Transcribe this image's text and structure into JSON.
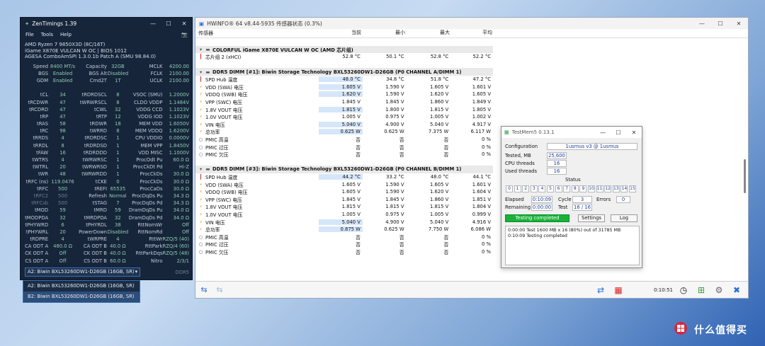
{
  "zt": {
    "title": "ZenTimings 1.39",
    "menu": [
      "File",
      "Tools",
      "Help"
    ],
    "info": [
      "AMD Ryzen 7 9850X3D (8C/16T)",
      "iGame X870E VULCAN W OC | BIOS 1012",
      "AGESA ComboAmSPI 1.3.0.1b Patch A (SMU 98.84.0)"
    ],
    "rows": [
      [
        "Speed",
        "8400 MT/s",
        "Capacity",
        "32GB",
        "MCLK",
        "4200.00"
      ],
      [
        "BGS",
        "Enabled",
        "BGS Alt",
        "Disabled",
        "FCLK",
        "2100.00"
      ],
      [
        "GDM",
        "Enabled",
        "Cmd2T",
        "1T",
        "UCLK",
        "2100.00"
      ],
      [
        "",
        "",
        "",
        "",
        "",
        ""
      ],
      [
        "tCL",
        "34",
        "tRDRDSCL",
        "8",
        "VSOC (SMU)",
        "1.2000V"
      ],
      [
        "tRCDWR",
        "47",
        "tWRWRSCL",
        "8",
        "CLDO VDDP",
        "1.1484V"
      ],
      [
        "tRCDRD",
        "47",
        "tCWL",
        "32",
        "VDDG CCD",
        "1.1023V"
      ],
      [
        "tRP",
        "47",
        "tRTP",
        "12",
        "VDDG IOD",
        "1.1023V"
      ],
      [
        "tRAS",
        "58",
        "tRDWR",
        "18",
        "MEM VDD",
        "1.6050V"
      ],
      [
        "tRC",
        "98",
        "tWRRD",
        "8",
        "MEM VDDQ",
        "1.6200V"
      ],
      [
        "tRRDS",
        "4",
        "tRDRDSC",
        "1",
        "CPU VDDIO",
        "0.0000V"
      ],
      [
        "tRRDL",
        "8",
        "tRDRDSD",
        "1",
        "MEM VPP",
        "1.8450V"
      ],
      [
        "tFAW",
        "16",
        "tRDRDDD",
        "1",
        "VDD MISC",
        "1.1000V"
      ],
      [
        "tWTRS",
        "4",
        "tWRWRSC",
        "1",
        "ProcOdt Pu",
        "60.0 Ω"
      ],
      [
        "tWTRL",
        "20",
        "tWRWRSD",
        "1",
        "ProcCkDt Pd",
        "Hi-Z"
      ],
      [
        "tWR",
        "48",
        "tWRWRDD",
        "1",
        "ProcCkDs",
        "30.0 Ω"
      ],
      [
        "tRFC (ns)",
        "119.0476",
        "tCKE",
        "0",
        "ProcCkDs",
        "30.0 Ω"
      ],
      [
        "tRFC",
        "500",
        "tREFI",
        "65535",
        "ProcCaDs",
        "30.0 Ω"
      ],
      [
        "tRFC2",
        "500",
        "Refresh",
        "Normal",
        "ProcDqDs Pu",
        "34.3 Ω"
      ],
      [
        "tRFCsb",
        "500",
        "tSTAG",
        "7",
        "ProcDqDs Pd",
        "34.3 Ω"
      ],
      [
        "tMOD",
        "59",
        "tMRD",
        "59",
        "DramDqDs Pu",
        "34.0 Ω"
      ],
      [
        "tMODPDA",
        "32",
        "tMRDPDA",
        "32",
        "DramDqDs Pd",
        "34.0 Ω"
      ],
      [
        "tPHYWRD",
        "6",
        "tPHYRDL",
        "38",
        "RttNomWr",
        "Off"
      ],
      [
        "tPHYWRL",
        "20",
        "PowerDown",
        "Disabled",
        "RttNomRd",
        "Off"
      ],
      [
        "tRDPRE",
        "4",
        "tWRPRE",
        "4",
        "RttWr",
        "RZQ/5 (40)"
      ],
      [
        "CA ODT A",
        "480.0 Ω",
        "CA ODT B",
        "40.0 Ω",
        "RttPark",
        "RZQ/4 (60)"
      ],
      [
        "CK ODT A",
        "Off",
        "CK ODT B",
        "40.0 Ω",
        "RttParkDqs",
        "RZQ/5 (48)"
      ],
      [
        "CS ODT A",
        "Off",
        "CS ODT B",
        "60.0 Ω",
        "Nitro",
        "2/3/1"
      ]
    ],
    "select": "A2: Biwin BXL53260DW1-D26GB (16GB, SR)",
    "ddr": "DDR5",
    "options": [
      "A2: Biwin BXL53260DW1-D26GB (16GB, SR)",
      "B2: Biwin BXL53260DW1-D26GB (16GB, SR)"
    ]
  },
  "hw": {
    "title": "HWiNFO® 64 v8.44-5935 传感器状态 (0.3%)",
    "headers": [
      "传感器",
      "当前",
      "最小",
      "最大",
      "平均"
    ],
    "rows": [
      {
        "t": "blank"
      },
      {
        "t": "g",
        "n": "COLORFUL iGame X870E VULCAN W OC (AMD 芯片组)"
      },
      {
        "t": "r",
        "i": "r",
        "n": "芯片组 2 (xHCI)",
        "v": [
          "52.8 °C",
          "50.1 °C",
          "52.8 °C",
          "52.2 °C"
        ]
      },
      {
        "t": "blank"
      },
      {
        "t": "g",
        "n": "DDR5 DIMM [#1]: Biwin Storage Technology BXL53260DW1-D26GB (P0 CHANNEL A/DIMM 1)"
      },
      {
        "t": "r",
        "i": "r",
        "n": "SPD Hub 温度",
        "v": [
          "48.0 °C",
          "34.8 °C",
          "51.8 °C",
          "47.2 °C"
        ],
        "h": true
      },
      {
        "t": "r",
        "i": "y",
        "n": "VDD (SWA) 电压",
        "v": [
          "1.605 V",
          "1.590 V",
          "1.605 V",
          "1.601 V"
        ],
        "h": true
      },
      {
        "t": "r",
        "i": "y",
        "n": "VDDQ (SWB) 电压",
        "v": [
          "1.620 V",
          "1.590 V",
          "1.620 V",
          "1.605 V"
        ],
        "h": true
      },
      {
        "t": "r",
        "i": "y",
        "n": "VPP (SWC) 电压",
        "v": [
          "1.845 V",
          "1.845 V",
          "1.860 V",
          "1.849 V"
        ]
      },
      {
        "t": "r",
        "i": "y",
        "n": "1.8V VOUT 电压",
        "v": [
          "1.815 V",
          "1.800 V",
          "1.815 V",
          "1.805 V"
        ],
        "h": true
      },
      {
        "t": "r",
        "i": "y",
        "n": "1.0V VOUT 电压",
        "v": [
          "1.005 V",
          "0.975 V",
          "1.005 V",
          "1.002 V"
        ]
      },
      {
        "t": "r",
        "i": "y",
        "n": "VIN 电压",
        "v": [
          "5.040 V",
          "4.900 V",
          "5.040 V",
          "4.917 V"
        ],
        "h": true
      },
      {
        "t": "r",
        "i": "y",
        "n": "总功率",
        "v": [
          "0.625 W",
          "0.625 W",
          "7.375 W",
          "6.117 W"
        ],
        "h": true
      },
      {
        "t": "r",
        "i": "b",
        "n": "PMIC 高温",
        "v": [
          "否",
          "否",
          "否",
          "0 %"
        ]
      },
      {
        "t": "r",
        "i": "b",
        "n": "PMIC 过压",
        "v": [
          "否",
          "否",
          "否",
          "0 %"
        ]
      },
      {
        "t": "r",
        "i": "b",
        "n": "PMIC 欠压",
        "v": [
          "否",
          "否",
          "否",
          "0 %"
        ]
      },
      {
        "t": "blank"
      },
      {
        "t": "g",
        "n": "DDR5 DIMM [#3]: Biwin Storage Technology BXL53260DW1-D26GB (P0 CHANNEL B/DIMM 1)"
      },
      {
        "t": "r",
        "i": "r",
        "n": "SPD Hub 温度",
        "v": [
          "44.2 °C",
          "33.2 °C",
          "48.0 °C",
          "44.1 °C"
        ],
        "h": true
      },
      {
        "t": "r",
        "i": "y",
        "n": "VDD (SWA) 电压",
        "v": [
          "1.605 V",
          "1.590 V",
          "1.605 V",
          "1.601 V"
        ]
      },
      {
        "t": "r",
        "i": "y",
        "n": "VDDQ (SWB) 电压",
        "v": [
          "1.605 V",
          "1.590 V",
          "1.620 V",
          "1.604 V"
        ]
      },
      {
        "t": "r",
        "i": "y",
        "n": "VPP (SWC) 电压",
        "v": [
          "1.845 V",
          "1.845 V",
          "1.860 V",
          "1.851 V"
        ]
      },
      {
        "t": "r",
        "i": "y",
        "n": "1.8V VOUT 电压",
        "v": [
          "1.815 V",
          "1.815 V",
          "1.815 V",
          "1.804 V"
        ]
      },
      {
        "t": "r",
        "i": "y",
        "n": "1.0V VOUT 电压",
        "v": [
          "1.005 V",
          "0.975 V",
          "1.005 V",
          "0.999 V"
        ]
      },
      {
        "t": "r",
        "i": "y",
        "n": "VIN 电压",
        "v": [
          "5.040 V",
          "4.900 V",
          "5.040 V",
          "4.916 V"
        ],
        "h": true
      },
      {
        "t": "r",
        "i": "y",
        "n": "总功率",
        "v": [
          "0.875 W",
          "0.625 W",
          "7.750 W",
          "6.086 W"
        ],
        "h": true
      },
      {
        "t": "r",
        "i": "b",
        "n": "PMIC 高温",
        "v": [
          "否",
          "否",
          "否",
          "0 %"
        ]
      },
      {
        "t": "r",
        "i": "b",
        "n": "PMIC 过压",
        "v": [
          "否",
          "否",
          "否",
          "0 %"
        ]
      },
      {
        "t": "r",
        "i": "b",
        "n": "PMIC 欠压",
        "v": [
          "否",
          "否",
          "否",
          "0 %"
        ]
      }
    ],
    "time": "0:10:51"
  },
  "tm": {
    "title": "TestMem5  0.13.1",
    "config_label": "Configuration",
    "config": "1usmus v3 @ 1usmus",
    "tested_label": "Tested, MB",
    "tested": "25,600",
    "cpu_label": "CPU threads",
    "cpu": "16",
    "used_label": "Used threads",
    "used": "16",
    "status_label": "Status",
    "tests": [
      "0",
      "1",
      "2",
      "3",
      "4",
      "5",
      "6",
      "7",
      "8",
      "9",
      "10",
      "11",
      "12",
      "13",
      "14",
      "15"
    ],
    "elapsed_label": "Elapsed",
    "elapsed": "0:10:09",
    "cycle_label": "Cycle",
    "cycle": "3",
    "errors_label": "Errors",
    "errors": "0",
    "remaining_label": "Remaining",
    "remaining": "0:00:00",
    "test_label": "Test",
    "test": "16 / 16",
    "btn_status": "Testing completed",
    "btn_settings": "Settings",
    "btn_log": "Log",
    "log": [
      "0:00:00  Test 1600 MB x 16 (80%) out of 31785 MB",
      "0:10:09  Testing completed"
    ]
  },
  "brand": "什么值得买"
}
